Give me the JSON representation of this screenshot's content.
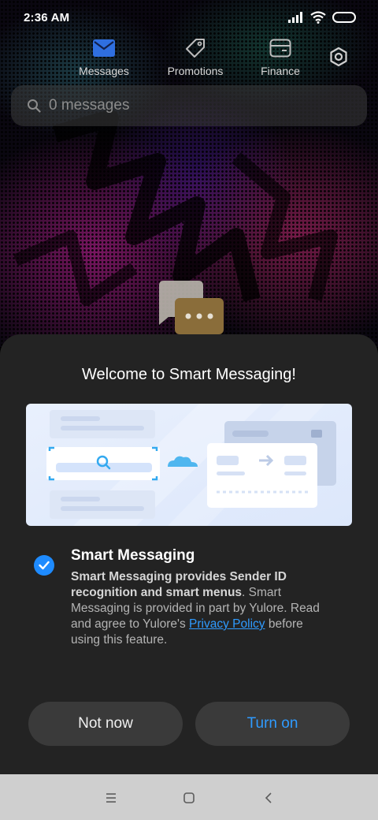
{
  "status_bar": {
    "time": "2:36 AM"
  },
  "tabs": [
    {
      "label": "Messages",
      "icon": "envelope-icon",
      "active": true
    },
    {
      "label": "Promotions",
      "icon": "tag-icon",
      "active": false
    },
    {
      "label": "Finance",
      "icon": "card-icon",
      "active": false
    }
  ],
  "settings": {
    "icon": "gear-icon"
  },
  "search": {
    "placeholder": "0 messages",
    "icon": "search-icon"
  },
  "dialog": {
    "title": "Welcome to Smart Messaging!",
    "option": {
      "checked": true,
      "title": "Smart Messaging",
      "desc_bold": "Smart Messaging provides Sender ID recognition and smart menus",
      "desc_part1": ". Smart Messaging is provided in part by Yulore. Read and agree to Yulore's ",
      "link": "Privacy Policy",
      "desc_part2": " before using this feature."
    },
    "buttons": {
      "not_now": "Not now",
      "turn_on": "Turn on"
    }
  },
  "colors": {
    "accent": "#1e8bff",
    "sheet": "#232323",
    "button_bg": "#3a3a3a"
  }
}
